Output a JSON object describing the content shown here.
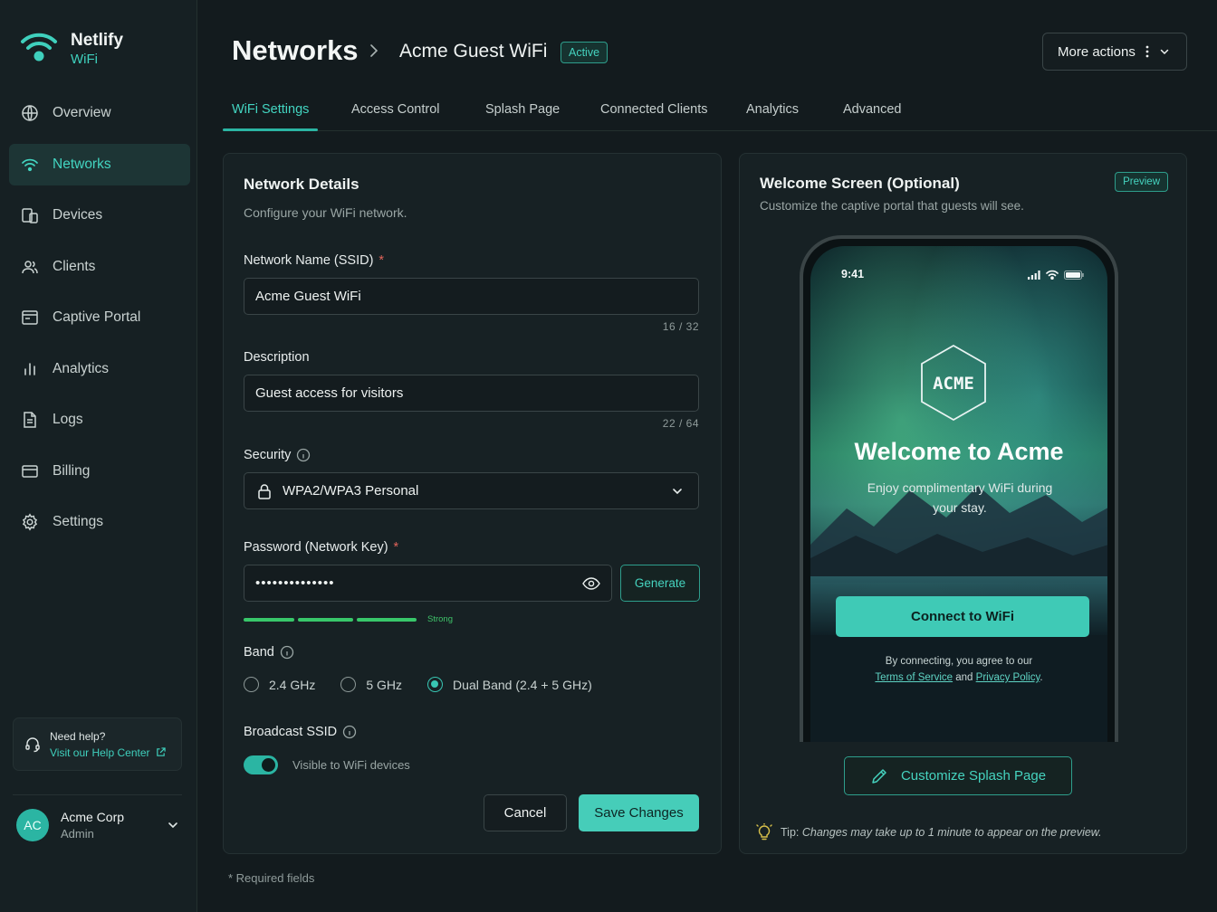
{
  "brand": {
    "name": "Netlify",
    "sub": "WiFi"
  },
  "sidebar": {
    "items": [
      {
        "label": "Overview"
      },
      {
        "label": "Networks"
      },
      {
        "label": "Devices"
      },
      {
        "label": "Clients"
      },
      {
        "label": "Captive Portal"
      },
      {
        "label": "Analytics"
      },
      {
        "label": "Logs"
      },
      {
        "label": "Billing"
      },
      {
        "label": "Settings"
      }
    ],
    "active": "Networks",
    "help": {
      "title": "Need help?",
      "link": "Visit our Help Center"
    },
    "user": {
      "initials": "AC",
      "name": "Acme Corp",
      "role": "Admin"
    }
  },
  "header": {
    "title": "Networks",
    "crumb": "Acme Guest WiFi",
    "status": "Active",
    "more_actions": "More actions"
  },
  "tabs": [
    {
      "label": "WiFi Settings"
    },
    {
      "label": "Access Control"
    },
    {
      "label": "Splash Page"
    },
    {
      "label": "Connected Clients"
    },
    {
      "label": "Analytics"
    },
    {
      "label": "Advanced"
    }
  ],
  "form": {
    "title": "Network Details",
    "subtitle": "Configure your WiFi network.",
    "ssid": {
      "label": "Network Name (SSID)",
      "required": "*",
      "value": "Acme Guest WiFi",
      "count": "16 / 32"
    },
    "description": {
      "label": "Description",
      "value": "Guest access for visitors",
      "count": "22 / 64"
    },
    "security": {
      "label": "Security",
      "value": "WPA2/WPA3 Personal"
    },
    "password": {
      "label": "Password (Network Key)",
      "required": "*",
      "value": "••••••••••••••",
      "generate": "Generate",
      "strength": "Strong",
      "strength_fraction": 1.0
    },
    "band": {
      "label": "Band",
      "options": [
        "2.4 GHz",
        "5 GHz",
        "Dual Band (2.4 + 5 GHz)"
      ],
      "selected": "Dual Band (2.4 + 5 GHz)"
    },
    "broadcast": {
      "label": "Broadcast SSID",
      "toggle_text": "Visible to WiFi devices",
      "enabled": true
    },
    "cancel": "Cancel",
    "save": "Save Changes",
    "required_note": "* Required fields"
  },
  "preview": {
    "title": "Welcome Screen (Optional)",
    "subtitle": "Customize the captive portal that guests will see.",
    "badge": "Preview",
    "phone": {
      "time": "9:41",
      "logo": "ACME",
      "welcome": "Welcome to Acme",
      "message": "Enjoy complimentary WiFi during your stay.",
      "connect": "Connect to WiFi",
      "agree_prefix": "By connecting, you agree to our",
      "terms": "Terms of Service",
      "and": "and",
      "privacy": "Privacy Policy",
      "period": "."
    },
    "customize": "Customize Splash Page",
    "tip_label": "Tip:",
    "tip_text": "Changes may take up to 1 minute to appear on the preview."
  },
  "colors": {
    "accent": "#43d5c1",
    "strength": "#38c76a",
    "required": "#e0645a"
  }
}
